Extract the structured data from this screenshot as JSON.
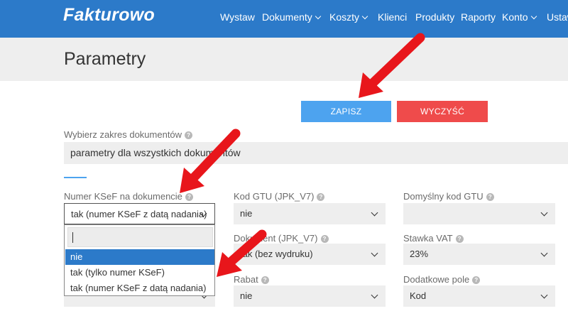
{
  "header": {
    "logo": "Fakturowo",
    "nav": [
      {
        "label": "Wystaw",
        "dropdown": false
      },
      {
        "label": "Dokumenty",
        "dropdown": true
      },
      {
        "label": "Koszty",
        "dropdown": true
      },
      {
        "label": "Klienci",
        "dropdown": false
      },
      {
        "label": "Produkty",
        "dropdown": false
      },
      {
        "label": "Raporty",
        "dropdown": false
      },
      {
        "label": "Konto",
        "dropdown": true
      },
      {
        "label": "Ustaw",
        "dropdown": false
      }
    ]
  },
  "page": {
    "title": "Parametry"
  },
  "actions": {
    "save_label": "ZAPISZ",
    "clear_label": "WYCZYŚĆ"
  },
  "scope": {
    "label": "Wybierz zakres dokumentów",
    "value": "parametry dla wszystkich dokumentów"
  },
  "fields": {
    "ksef": {
      "label": "Numer KSeF na dokumencie",
      "value": "tak (numer KSeF z datą nadania)"
    },
    "gtu": {
      "label": "Kod GTU (JPK_V7)",
      "value": "nie"
    },
    "default_gtu": {
      "label": "Domyślny kod GTU",
      "value": ""
    },
    "doc": {
      "label": "Dokument (JPK_V7)",
      "value": "tak (bez wydruku)"
    },
    "vat": {
      "label": "Stawka VAT",
      "value": "23%"
    },
    "hidden": {
      "value": ""
    },
    "rebate": {
      "label": "Rabat",
      "value": "nie"
    },
    "extra": {
      "label": "Dodatkowe pole",
      "value": "Kod"
    }
  },
  "dropdown": {
    "search_value": "",
    "options": [
      "nie",
      "tak (tylko numer KSeF)",
      "tak (numer KSeF z datą nadania)"
    ],
    "highlighted_index": 0
  },
  "colors": {
    "nav_bg": "#2c7ac9",
    "save": "#4da3ef",
    "clear": "#ef4b4b",
    "arrow": "#e8161b"
  },
  "icons": {
    "help": "question-circle-icon",
    "arrow": "red-arrow-annotation"
  }
}
